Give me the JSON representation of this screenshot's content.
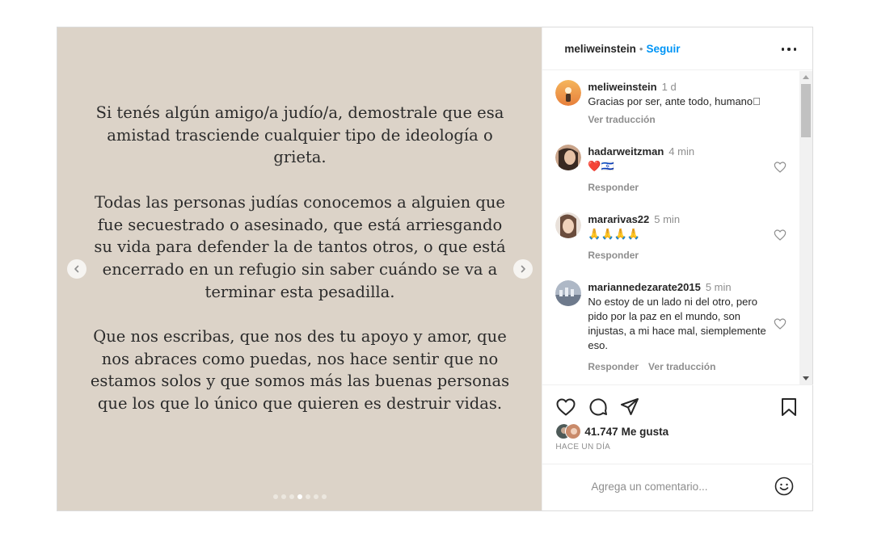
{
  "header": {
    "username": "meliweinstein",
    "separator": "•",
    "follow_label": "Seguir",
    "more_icon": "more-horizontal-icon"
  },
  "post": {
    "paragraphs": [
      "Si tenés algún amigo/a judío/a, demostrale que esa amistad trasciende cualquier tipo de ideología o grieta.",
      "Todas las personas judías conocemos a alguien que fue secuestrado o asesinado, que está arriesgando su vida para defender la de tantos otros, o que está encerrado en un refugio sin saber cuándo se va a terminar esta pesadilla.",
      "Que nos escribas, que nos des tu apoyo y amor, que nos abraces como puedas, nos hace sentir que no estamos solos y que somos más las buenas personas que los que lo único que quieren es destruir vidas."
    ],
    "background_color": "#dcd3c8",
    "carousel": {
      "total": 7,
      "active_index": 3
    }
  },
  "comments": [
    {
      "username": "meliweinstein",
      "time": "1 d",
      "text": "Gracias por ser, ante todo, humano\u0000",
      "actions": [
        "Ver traducción"
      ],
      "has_like": false
    },
    {
      "username": "hadarweitzman",
      "time": "4 min",
      "text": "❤️🇮🇱",
      "actions": [
        "Responder"
      ],
      "has_like": true
    },
    {
      "username": "mararivas22",
      "time": "5 min",
      "text": "🙏🙏🙏🙏",
      "actions": [
        "Responder"
      ],
      "has_like": true
    },
    {
      "username": "mariannedezarate2015",
      "time": "5 min",
      "text": "No estoy de un lado ni del otro, pero pido por la paz en el mundo, son injustas, a mi hace mal, siemplemente eso.",
      "actions": [
        "Responder",
        "Ver traducción"
      ],
      "has_like": true
    }
  ],
  "actions": {
    "icons": [
      "heart-icon",
      "comment-icon",
      "share-icon",
      "bookmark-icon"
    ],
    "likes_count": "41.747",
    "likes_label": "Me gusta",
    "time_ago": "HACE UN DÍA"
  },
  "add_comment": {
    "placeholder": "Agrega un comentario...",
    "emoji_icon": "smile-icon"
  },
  "colors": {
    "accent": "#0095f6",
    "muted": "#8e8e8e",
    "text": "#262626",
    "border": "#dbdbdb"
  }
}
